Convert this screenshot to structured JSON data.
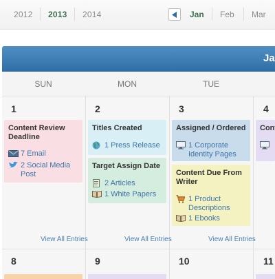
{
  "nav": {
    "years": [
      "2012",
      "2013",
      "2014"
    ],
    "active_year": "2013",
    "months": [
      "Jan",
      "Feb",
      "Mar"
    ],
    "active_month": "Jan"
  },
  "month_title": "Ja",
  "weekdays": [
    "SUN",
    "MON",
    "TUE"
  ],
  "days": {
    "sun": {
      "number": "1",
      "card": {
        "title_line1": "Content Review",
        "title_line2": "Deadline",
        "items": [
          "7 Email",
          "2 Social Media",
          "Post"
        ]
      },
      "view_all": "View All Entries"
    },
    "mon": {
      "number": "2",
      "card1": {
        "title": "Titles Created",
        "items": [
          "1 Press Release"
        ]
      },
      "card2": {
        "title": "Target Assign Date",
        "items": [
          "2 Articles",
          "1 White Papers"
        ]
      },
      "view_all": "View All Entries"
    },
    "tue": {
      "number": "3",
      "card1": {
        "title": "Assigned / Ordered",
        "items": [
          "1 Corporate",
          "Identity Pages"
        ]
      },
      "card2": {
        "title_line1": "Content Due From",
        "title_line2": "Writer",
        "items": [
          "1 Product",
          "Descriptions",
          "1 Ebooks"
        ]
      },
      "view_all": "View All Entries"
    },
    "wed": {
      "number": "4",
      "card_title": "Cont"
    }
  },
  "next_week": [
    "8",
    "9",
    "10",
    "11"
  ],
  "colors": {
    "pink": "#f9dfe3",
    "cyan": "#d8f0f5",
    "green": "#d5eddf",
    "blue": "#c9dcec",
    "yellow": "#f5f2c2",
    "lavender": "#e3dcf2",
    "orange": "#f8d3a8",
    "header_blue": "#2f6ea5"
  },
  "icons": [
    "envelope-icon",
    "twitter-bird-icon",
    "globe-icon",
    "document-icon",
    "book-icon",
    "monitor-icon",
    "cart-icon"
  ]
}
